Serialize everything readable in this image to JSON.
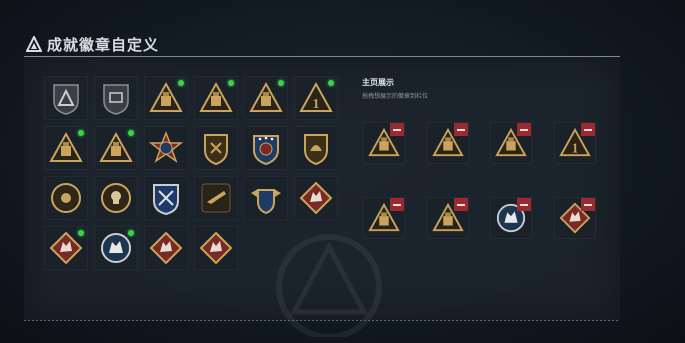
{
  "header": {
    "title": "成就徽章自定义",
    "logo_icon": "triangle-logo-icon"
  },
  "colors": {
    "accent_green": "#3bd24a",
    "remove_red": "#9a2a2f",
    "gold": "#c9a45c",
    "crimson_badge": "#7a2a25",
    "navy_badge": "#1e3a66"
  },
  "collection": {
    "badges": [
      {
        "icon": "grey-triangle-shield-badge-icon",
        "kind": "shield-grey",
        "new": false
      },
      {
        "icon": "grey-cargo-shield-badge-icon",
        "kind": "shield-grey2",
        "new": false
      },
      {
        "icon": "gold-trophy-triangle-badge-icon",
        "kind": "tri",
        "new": true
      },
      {
        "icon": "gold-crate-triangle-badge-icon",
        "kind": "tri",
        "new": true
      },
      {
        "icon": "gold-helmet-triangle-badge-icon",
        "kind": "tri",
        "new": true
      },
      {
        "icon": "gold-number-one-triangle-badge-icon",
        "kind": "tri-one",
        "new": true
      },
      {
        "icon": "gold-canister-triangle-badge-icon",
        "kind": "tri",
        "new": true
      },
      {
        "icon": "gold-soldier-triangle-badge-icon",
        "kind": "tri",
        "new": true
      },
      {
        "icon": "red-star-medal-badge-icon",
        "kind": "medal-red",
        "new": false
      },
      {
        "icon": "gold-rifle-shield-badge-icon",
        "kind": "shield-gold",
        "new": false
      },
      {
        "icon": "navy-star-shield-badge-icon",
        "kind": "shield-navy",
        "new": false
      },
      {
        "icon": "gold-eagle-shield-badge-icon",
        "kind": "shield-gold2",
        "new": false
      },
      {
        "icon": "bronze-disc-badge-icon",
        "kind": "disc",
        "new": false
      },
      {
        "icon": "bronze-skull-disc-badge-icon",
        "kind": "disc2",
        "new": false
      },
      {
        "icon": "navy-crossed-weapons-badge-icon",
        "kind": "shield-navy2",
        "new": false
      },
      {
        "icon": "gold-rifle-badge-icon",
        "kind": "gun",
        "new": false
      },
      {
        "icon": "gold-winged-shield-badge-icon",
        "kind": "shield-wing",
        "new": false
      },
      {
        "icon": "red-wolf-diamond-badge-icon",
        "kind": "diamond",
        "new": false
      },
      {
        "icon": "red-wolf-diamond-badge-icon",
        "kind": "diamond",
        "new": true
      },
      {
        "icon": "silver-wolf-disc-badge-icon",
        "kind": "disc-wolf",
        "new": true
      },
      {
        "icon": "red-wolf-diamond-badge-icon",
        "kind": "diamond",
        "new": false
      },
      {
        "icon": "red-wolf-diamond-badge-icon",
        "kind": "diamond",
        "new": false
      }
    ]
  },
  "showcase": {
    "title": "主页展示",
    "subtitle": "拖拽想展示的徽章到栏位",
    "slots": [
      {
        "icon": "gold-canister-triangle-badge-icon",
        "kind": "tri"
      },
      {
        "icon": "gold-soldier-triangle-badge-icon",
        "kind": "tri"
      },
      {
        "icon": "gold-helmet-triangle-badge-icon",
        "kind": "tri"
      },
      {
        "icon": "gold-number-one-triangle-badge-icon",
        "kind": "tri-one"
      },
      {
        "icon": "gold-lantern-triangle-badge-icon",
        "kind": "tri"
      },
      {
        "icon": "gold-crate-triangle-badge-icon",
        "kind": "tri"
      },
      {
        "icon": "silver-wolf-disc-badge-icon",
        "kind": "disc-wolf"
      },
      {
        "icon": "red-wolf-diamond-badge-icon",
        "kind": "diamond"
      }
    ],
    "remove_icon": "minus-icon"
  }
}
